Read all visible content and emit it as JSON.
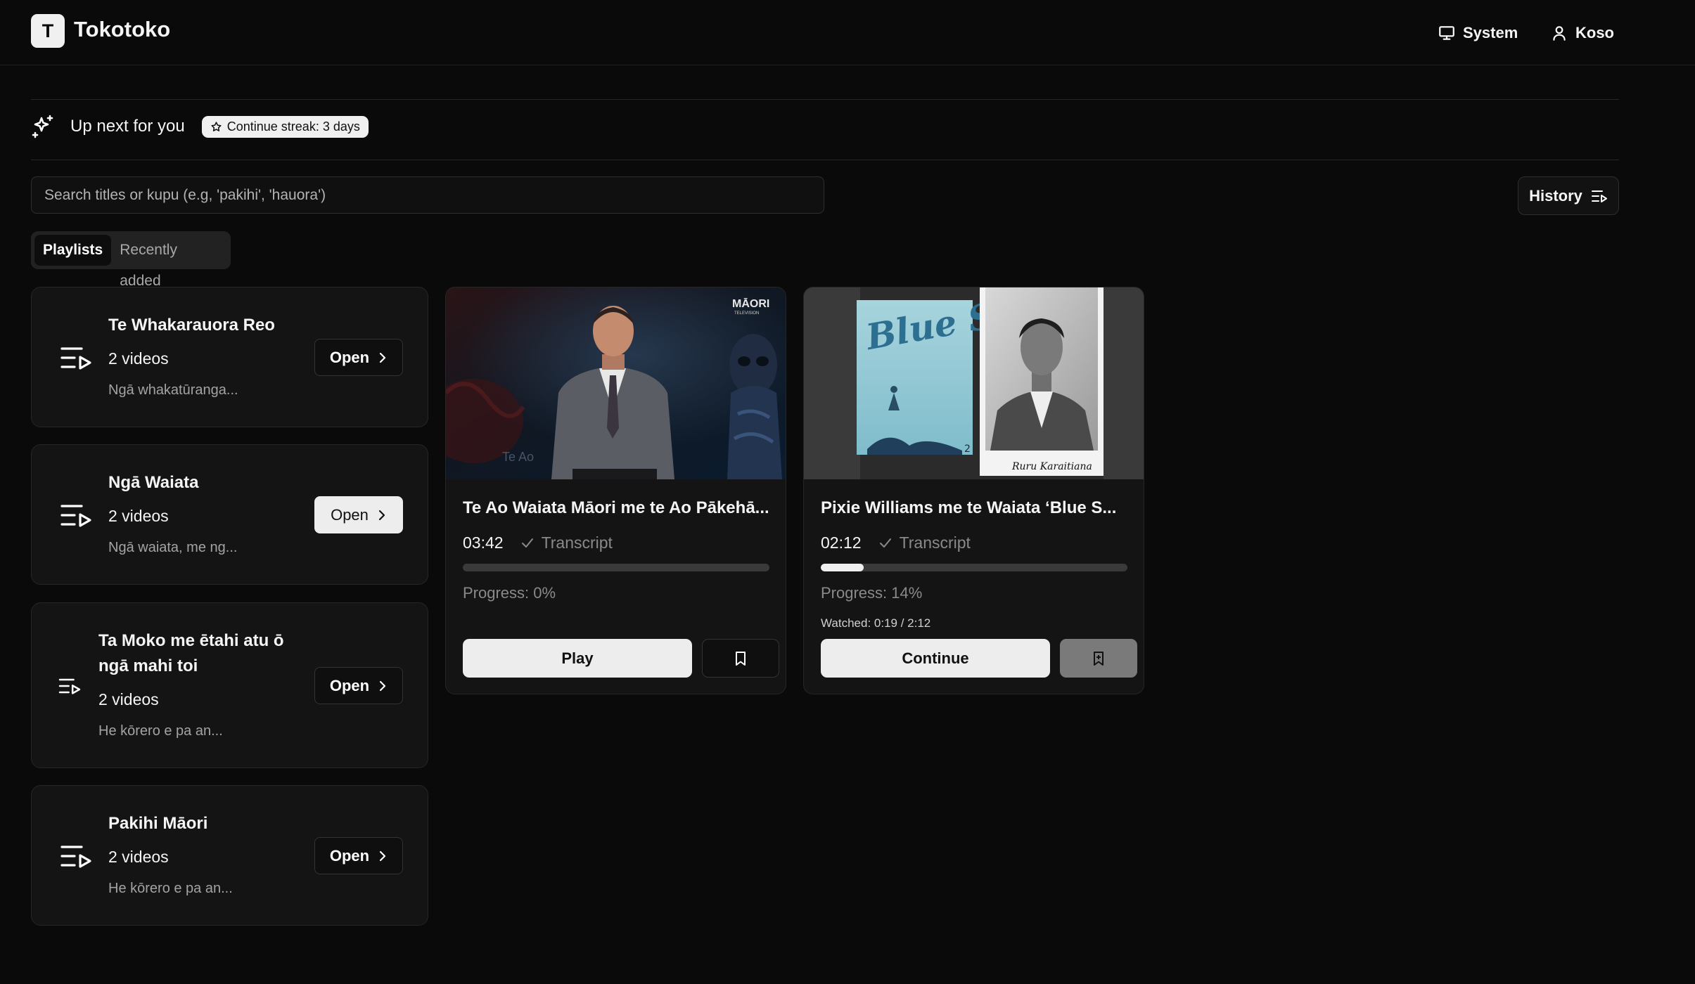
{
  "app": {
    "logo_letter": "T",
    "name": "Tokotoko"
  },
  "header": {
    "system_label": "System",
    "user_label": "Koso"
  },
  "up_next": {
    "title": "Up next for you",
    "streak_label": "Continue streak: 3 days"
  },
  "search": {
    "placeholder": "Search titles or kupu (e.g, 'pakihi', 'hauora')"
  },
  "history_button": {
    "label": "History"
  },
  "tabs": [
    {
      "label": "Playlists",
      "active": true
    },
    {
      "label": "Recently added",
      "active": false
    }
  ],
  "playlists": [
    {
      "title": "Te Whakarauora Reo",
      "count": "2 videos",
      "description": "Ngā whakatūranga...",
      "open_label": "Open"
    },
    {
      "title": "Ngā Waiata",
      "count": "2 videos",
      "description": "Ngā waiata, me ng...",
      "open_label": "Open"
    },
    {
      "title_line1": "Ta Moko me ētahi atu ō",
      "title_line2": "ngā mahi toi",
      "count": "2 videos",
      "description": "He kōrero e pa an...",
      "open_label": "Open"
    },
    {
      "title": "Pakihi Māori",
      "count": "2 videos",
      "description": "He kōrero e pa an...",
      "open_label": "Open"
    }
  ],
  "videos": [
    {
      "title": "Te Ao Waiata Māori me te Ao Pākehā...",
      "duration": "03:42",
      "transcript_label": "Transcript",
      "progress_percent": 0,
      "progress_label": "Progress: 0%",
      "action_label": "Play",
      "thumbnail_brand": "MĀORI",
      "thumbnail_brand_sub": "TELEVISION",
      "thumbnail_caption": "Te Ao"
    },
    {
      "title": "Pixie Williams me te Waiata ‘Blue S...",
      "duration": "02:12",
      "transcript_label": "Transcript",
      "progress_percent": 14,
      "progress_label": "Progress: 14%",
      "watched_label": "Watched: 0:19 / 2:12",
      "action_label": "Continue",
      "thumbnail_title": "Blue Smoke",
      "thumbnail_badge": "2",
      "thumbnail_caption": "Ruru Karaitiana"
    }
  ],
  "colors": {
    "background": "#0a0a0a",
    "card": "#141414",
    "accent": "#f0f0f0",
    "muted": "#8a8a8a"
  },
  "icons": [
    "sparkles-icon",
    "star-icon",
    "monitor-icon",
    "user-icon",
    "playlist-icon",
    "chevron-right-icon",
    "check-icon",
    "bookmark-icon"
  ]
}
